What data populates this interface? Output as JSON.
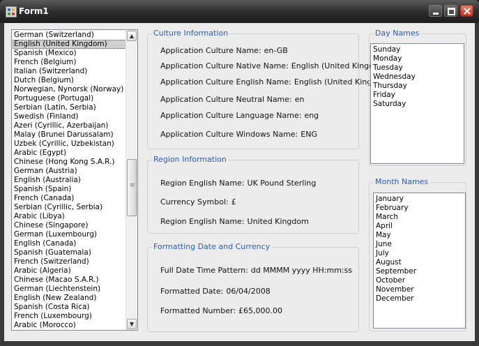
{
  "window": {
    "title": "Form1"
  },
  "cultures": {
    "items": [
      "German (Switzerland)",
      "English (United Kingdom)",
      "Spanish (Mexico)",
      "French (Belgium)",
      "Italian (Switzerland)",
      "Dutch (Belgium)",
      "Norwegian, Nynorsk (Norway)",
      "Portuguese (Portugal)",
      "Serbian (Latin, Serbia)",
      "Swedish (Finland)",
      "Azeri (Cyrillic, Azerbaijan)",
      "Malay (Brunei Darussalam)",
      "Uzbek (Cyrillic, Uzbekistan)",
      "Arabic (Egypt)",
      "Chinese (Hong Kong S.A.R.)",
      "German (Austria)",
      "English (Australia)",
      "Spanish (Spain)",
      "French (Canada)",
      "Serbian (Cyrillic, Serbia)",
      "Arabic (Libya)",
      "Chinese (Singapore)",
      "German (Luxembourg)",
      "English (Canada)",
      "Spanish (Guatemala)",
      "French (Switzerland)",
      "Arabic (Algeria)",
      "Chinese (Macao S.A.R.)",
      "German (Liechtenstein)",
      "English (New Zealand)",
      "Spanish (Costa Rica)",
      "French (Luxembourg)",
      "Arabic (Morocco)"
    ],
    "selected": "English (United Kingdom)"
  },
  "culture_info": {
    "legend": "Culture Information",
    "rows": [
      {
        "label": "Application Culture Name:",
        "value": "en-GB"
      },
      {
        "label": "Application Culture Native Name:",
        "value": "English (United Kingdom)"
      },
      {
        "label": "Application Culture English Name:",
        "value": "English (United Kingdom)"
      },
      {
        "label": "Application Culture Neutral Name:",
        "value": "en"
      },
      {
        "label": "Application Culture Language Name:",
        "value": "eng"
      },
      {
        "label": "Application Culture Windows Name:",
        "value": "ENG"
      }
    ]
  },
  "region_info": {
    "legend": "Region Information",
    "rows": [
      {
        "label": "Region English Name:",
        "value": "UK Pound Sterling"
      },
      {
        "label": "Currency Symbol:",
        "value": "£"
      },
      {
        "label": "Region English Name:",
        "value": "United Kingdom"
      }
    ]
  },
  "formatting": {
    "legend": "Formatting Date and Currency",
    "rows": [
      {
        "label": "Full Date Time Pattern:",
        "value": "dd MMMM yyyy HH:mm:ss"
      },
      {
        "label": "Formatted Date:",
        "value": "06/04/2008"
      },
      {
        "label": "Formatted Number:",
        "value": "£65,000.00"
      }
    ]
  },
  "day_names": {
    "legend": "Day Names",
    "items": [
      "Sunday",
      "Monday",
      "Tuesday",
      "Wednesday",
      "Thursday",
      "Friday",
      "Saturday"
    ]
  },
  "month_names": {
    "legend": "Month Names",
    "items": [
      "January",
      "February",
      "March",
      "April",
      "May",
      "June",
      "July",
      "August",
      "September",
      "October",
      "November",
      "December"
    ]
  },
  "icons": {
    "app": "app-window-icon",
    "minimize": "minimize-icon",
    "maximize": "maximize-icon",
    "close": "close-icon",
    "scroll_up": "chevron-up-icon",
    "scroll_down": "chevron-down-icon"
  },
  "colors": {
    "legend_text": "#2b5bb5",
    "close_button": "#c0301a"
  }
}
